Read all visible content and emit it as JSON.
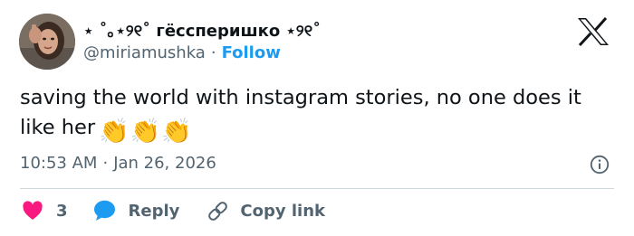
{
  "user": {
    "display_name": "⋆ ˚｡⋆୨୧˚ гёссперишко ⋆୨୧˚",
    "handle": "@miriamushka",
    "separator": "·",
    "follow_label": "Follow"
  },
  "tweet": {
    "text": "saving the world with instagram stories, no one does it like her",
    "emojis": [
      "👏",
      "👏",
      "👏"
    ]
  },
  "meta": {
    "time": "10:53 AM",
    "separator": "·",
    "date": "Jan 26, 2026"
  },
  "actions": {
    "like_count": "3",
    "reply_label": "Reply",
    "copy_link_label": "Copy link"
  },
  "colors": {
    "like": "#f91880",
    "reply": "#1d9bf0",
    "follow": "#1d9bf0",
    "secondary_text": "#536471"
  },
  "icons": {
    "brand": "x-logo-icon",
    "info": "info-icon",
    "like": "heart-icon",
    "reply": "speech-bubble-icon",
    "copy_link": "link-icon"
  }
}
